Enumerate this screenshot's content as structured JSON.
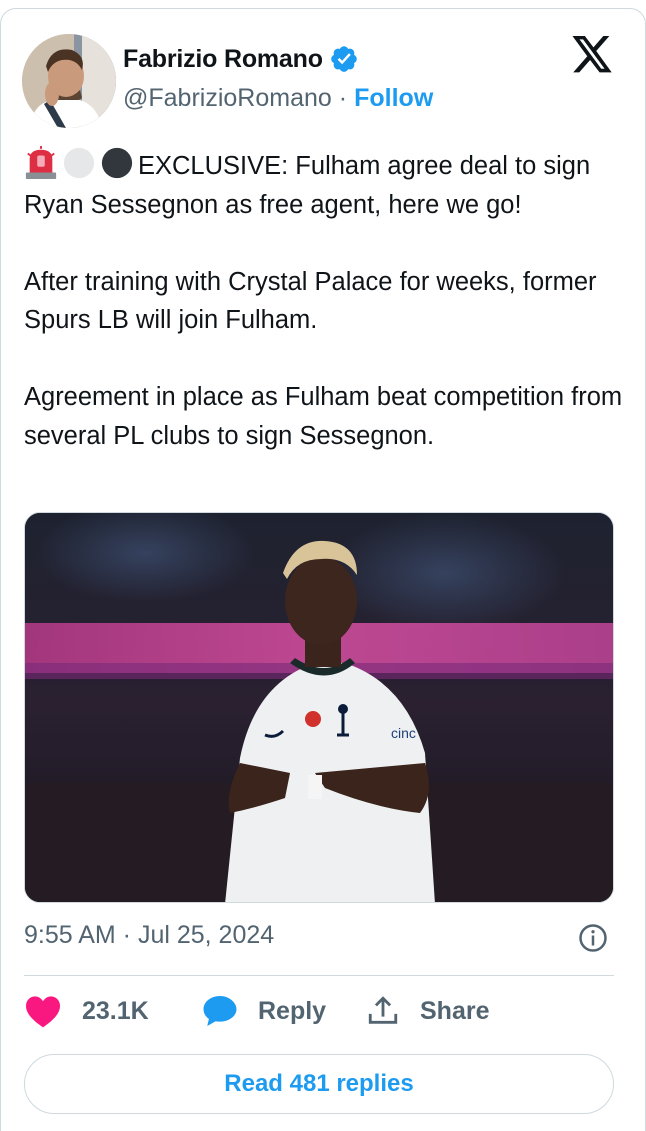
{
  "author": {
    "name": "Fabrizio Romano",
    "handle": "@FabrizioRomano",
    "separator": "·",
    "follow_label": "Follow"
  },
  "tweet": {
    "emojis": [
      "police-light-emoji",
      "white-circle-emoji",
      "black-circle-emoji"
    ],
    "paragraph1": "EXCLUSIVE: Fulham agree deal to sign Ryan Sessegnon as free agent, here we go!",
    "paragraph2": "After training with Crystal Palace for weeks, former Spurs LB will join Fulham.",
    "paragraph3": "Agreement in place as Fulham beat competition from several PL clubs to sign Sessegnon.",
    "timestamp": "9:55 AM · Jul 25, 2024"
  },
  "actions": {
    "likes_count": "23.1K",
    "reply_label": "Reply",
    "share_label": "Share",
    "read_replies_label": "Read 481 replies"
  },
  "colors": {
    "accent": "#1d9bf0",
    "like": "#f91880",
    "muted": "#536471",
    "border": "#cfd9de"
  }
}
